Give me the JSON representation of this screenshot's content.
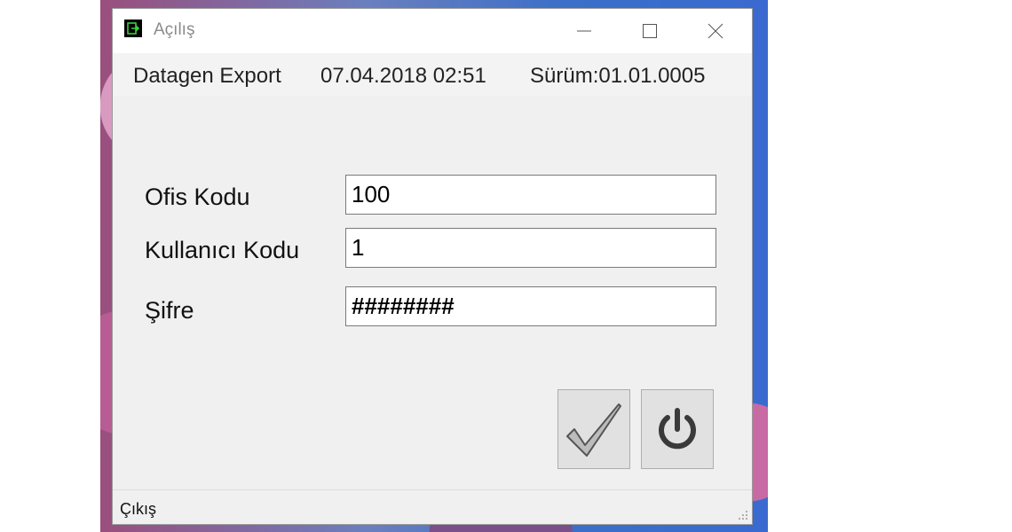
{
  "window": {
    "title": "Açılış",
    "icon": "export-app-icon",
    "controls": [
      "minimize-icon",
      "maximize-icon",
      "close-icon"
    ]
  },
  "infobar": {
    "app_name": "Datagen Export",
    "datetime": "07.04.2018 02:51",
    "version": "Sürüm:01.01.0005"
  },
  "form": {
    "office_code_label": "Ofis Kodu",
    "office_code_value": "100",
    "user_code_label": "Kullanıcı Kodu",
    "user_code_value": "1",
    "password_label": "Şifre",
    "password_value": "########"
  },
  "buttons": {
    "confirm_icon": "checkmark-icon",
    "power_icon": "power-icon"
  },
  "statusbar": {
    "text": "Çıkış"
  },
  "colors": {
    "accent_icon": "#39d139",
    "window_bg": "#f0f0f0",
    "button_bg": "#e1e1e1"
  }
}
